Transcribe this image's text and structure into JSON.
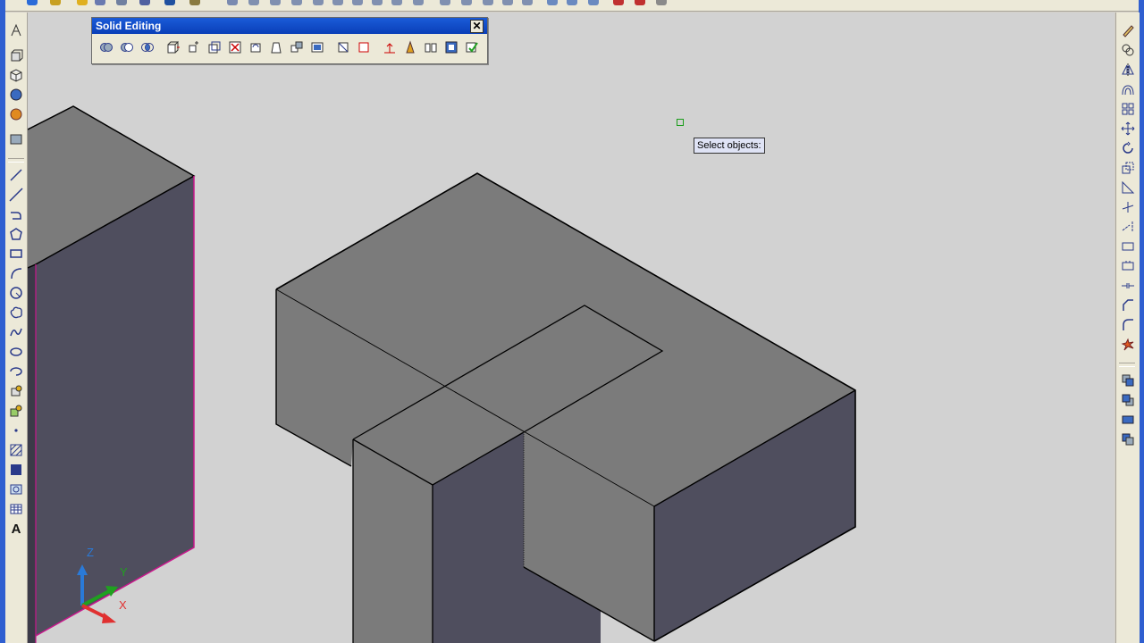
{
  "solid_editing_toolbar": {
    "title": "Solid Editing",
    "close_label": "✕"
  },
  "tooltip": {
    "prompt": "Select objects:"
  },
  "ucs_icon": {
    "x_label": "X",
    "y_label": "Y",
    "z_label": "Z"
  },
  "left_toolbar": {
    "text_tool_glyph": "A"
  },
  "colors": {
    "top_face": "#7b7b7b",
    "front_face": "#4f4e5e",
    "viewport_bg": "#d2d2d2",
    "highlight_edge": "#c8188c",
    "frame_blue": "#2f5fd0"
  }
}
